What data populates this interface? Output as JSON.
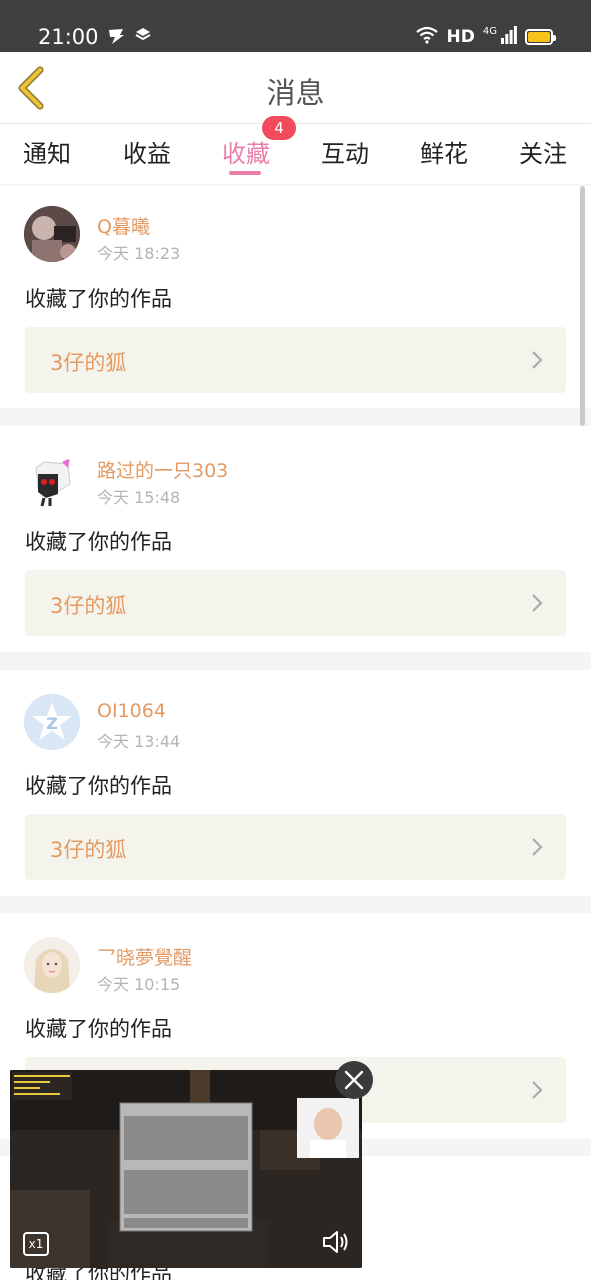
{
  "status_bar": {
    "time": "21:00",
    "network_label": "HD",
    "signal_label": "4G",
    "battery_color": "#f7c31b"
  },
  "header": {
    "title": "消息",
    "back_icon": "chevron-left-icon"
  },
  "tabs": [
    {
      "label": "通知",
      "active": false
    },
    {
      "label": "收益",
      "active": false
    },
    {
      "label": "收藏",
      "active": true,
      "badge": "4"
    },
    {
      "label": "互动",
      "active": false
    },
    {
      "label": "鲜花",
      "active": false
    },
    {
      "label": "关注",
      "active": false
    }
  ],
  "messages": [
    {
      "username": "Q暮曦",
      "time": "今天 18:23",
      "action": "收藏了你的作品",
      "work_title": "3仔的狐"
    },
    {
      "username": "路过的一只303",
      "time": "今天 15:48",
      "action": "收藏了你的作品",
      "work_title": "3仔的狐"
    },
    {
      "username": "OI1064",
      "time": "今天 13:44",
      "action": "收藏了你的作品",
      "work_title": "3仔的狐"
    },
    {
      "username": "乛晓夢覺醒",
      "time": "今天 10:15",
      "action": "收藏了你的作品",
      "work_title": ""
    }
  ],
  "peek_text": "收藏了你的作品",
  "video_overlay": {
    "speed_label": "x1",
    "close_icon": "close-icon",
    "volume_icon": "volume-icon"
  },
  "colors": {
    "accent_pink": "#ea7fa9",
    "username_orange": "#e39a63",
    "badge_red": "#f14a5b",
    "back_arrow_yellow": "#f1c232"
  }
}
